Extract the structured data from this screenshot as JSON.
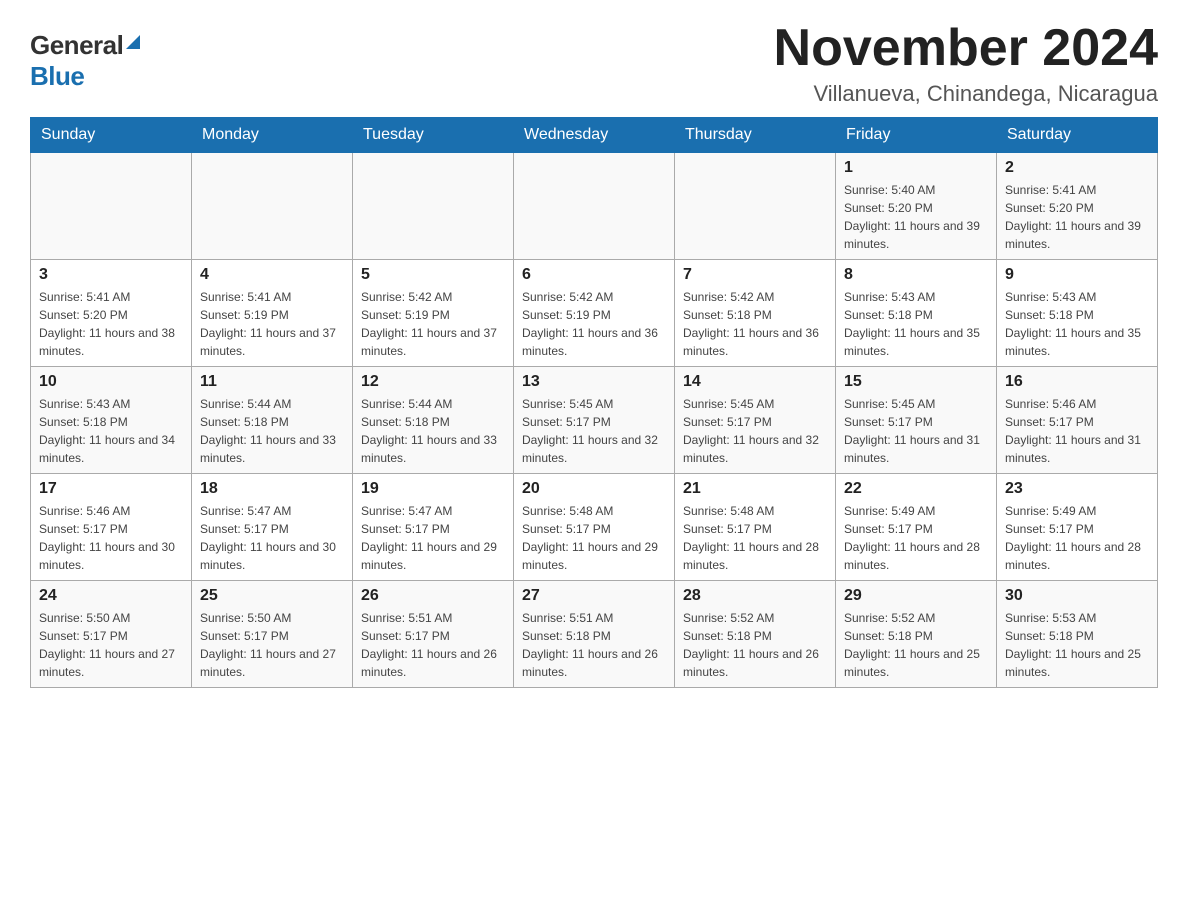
{
  "header": {
    "logo": {
      "general": "General",
      "blue": "Blue",
      "tagline": "GeneralBlue"
    },
    "title": "November 2024",
    "location": "Villanueva, Chinandega, Nicaragua"
  },
  "weekdays": [
    "Sunday",
    "Monday",
    "Tuesday",
    "Wednesday",
    "Thursday",
    "Friday",
    "Saturday"
  ],
  "weeks": [
    {
      "days": [
        {
          "number": "",
          "info": ""
        },
        {
          "number": "",
          "info": ""
        },
        {
          "number": "",
          "info": ""
        },
        {
          "number": "",
          "info": ""
        },
        {
          "number": "",
          "info": ""
        },
        {
          "number": "1",
          "info": "Sunrise: 5:40 AM\nSunset: 5:20 PM\nDaylight: 11 hours and 39 minutes."
        },
        {
          "number": "2",
          "info": "Sunrise: 5:41 AM\nSunset: 5:20 PM\nDaylight: 11 hours and 39 minutes."
        }
      ]
    },
    {
      "days": [
        {
          "number": "3",
          "info": "Sunrise: 5:41 AM\nSunset: 5:20 PM\nDaylight: 11 hours and 38 minutes."
        },
        {
          "number": "4",
          "info": "Sunrise: 5:41 AM\nSunset: 5:19 PM\nDaylight: 11 hours and 37 minutes."
        },
        {
          "number": "5",
          "info": "Sunrise: 5:42 AM\nSunset: 5:19 PM\nDaylight: 11 hours and 37 minutes."
        },
        {
          "number": "6",
          "info": "Sunrise: 5:42 AM\nSunset: 5:19 PM\nDaylight: 11 hours and 36 minutes."
        },
        {
          "number": "7",
          "info": "Sunrise: 5:42 AM\nSunset: 5:18 PM\nDaylight: 11 hours and 36 minutes."
        },
        {
          "number": "8",
          "info": "Sunrise: 5:43 AM\nSunset: 5:18 PM\nDaylight: 11 hours and 35 minutes."
        },
        {
          "number": "9",
          "info": "Sunrise: 5:43 AM\nSunset: 5:18 PM\nDaylight: 11 hours and 35 minutes."
        }
      ]
    },
    {
      "days": [
        {
          "number": "10",
          "info": "Sunrise: 5:43 AM\nSunset: 5:18 PM\nDaylight: 11 hours and 34 minutes."
        },
        {
          "number": "11",
          "info": "Sunrise: 5:44 AM\nSunset: 5:18 PM\nDaylight: 11 hours and 33 minutes."
        },
        {
          "number": "12",
          "info": "Sunrise: 5:44 AM\nSunset: 5:18 PM\nDaylight: 11 hours and 33 minutes."
        },
        {
          "number": "13",
          "info": "Sunrise: 5:45 AM\nSunset: 5:17 PM\nDaylight: 11 hours and 32 minutes."
        },
        {
          "number": "14",
          "info": "Sunrise: 5:45 AM\nSunset: 5:17 PM\nDaylight: 11 hours and 32 minutes."
        },
        {
          "number": "15",
          "info": "Sunrise: 5:45 AM\nSunset: 5:17 PM\nDaylight: 11 hours and 31 minutes."
        },
        {
          "number": "16",
          "info": "Sunrise: 5:46 AM\nSunset: 5:17 PM\nDaylight: 11 hours and 31 minutes."
        }
      ]
    },
    {
      "days": [
        {
          "number": "17",
          "info": "Sunrise: 5:46 AM\nSunset: 5:17 PM\nDaylight: 11 hours and 30 minutes."
        },
        {
          "number": "18",
          "info": "Sunrise: 5:47 AM\nSunset: 5:17 PM\nDaylight: 11 hours and 30 minutes."
        },
        {
          "number": "19",
          "info": "Sunrise: 5:47 AM\nSunset: 5:17 PM\nDaylight: 11 hours and 29 minutes."
        },
        {
          "number": "20",
          "info": "Sunrise: 5:48 AM\nSunset: 5:17 PM\nDaylight: 11 hours and 29 minutes."
        },
        {
          "number": "21",
          "info": "Sunrise: 5:48 AM\nSunset: 5:17 PM\nDaylight: 11 hours and 28 minutes."
        },
        {
          "number": "22",
          "info": "Sunrise: 5:49 AM\nSunset: 5:17 PM\nDaylight: 11 hours and 28 minutes."
        },
        {
          "number": "23",
          "info": "Sunrise: 5:49 AM\nSunset: 5:17 PM\nDaylight: 11 hours and 28 minutes."
        }
      ]
    },
    {
      "days": [
        {
          "number": "24",
          "info": "Sunrise: 5:50 AM\nSunset: 5:17 PM\nDaylight: 11 hours and 27 minutes."
        },
        {
          "number": "25",
          "info": "Sunrise: 5:50 AM\nSunset: 5:17 PM\nDaylight: 11 hours and 27 minutes."
        },
        {
          "number": "26",
          "info": "Sunrise: 5:51 AM\nSunset: 5:17 PM\nDaylight: 11 hours and 26 minutes."
        },
        {
          "number": "27",
          "info": "Sunrise: 5:51 AM\nSunset: 5:18 PM\nDaylight: 11 hours and 26 minutes."
        },
        {
          "number": "28",
          "info": "Sunrise: 5:52 AM\nSunset: 5:18 PM\nDaylight: 11 hours and 26 minutes."
        },
        {
          "number": "29",
          "info": "Sunrise: 5:52 AM\nSunset: 5:18 PM\nDaylight: 11 hours and 25 minutes."
        },
        {
          "number": "30",
          "info": "Sunrise: 5:53 AM\nSunset: 5:18 PM\nDaylight: 11 hours and 25 minutes."
        }
      ]
    }
  ],
  "accent_color": "#1a6faf"
}
